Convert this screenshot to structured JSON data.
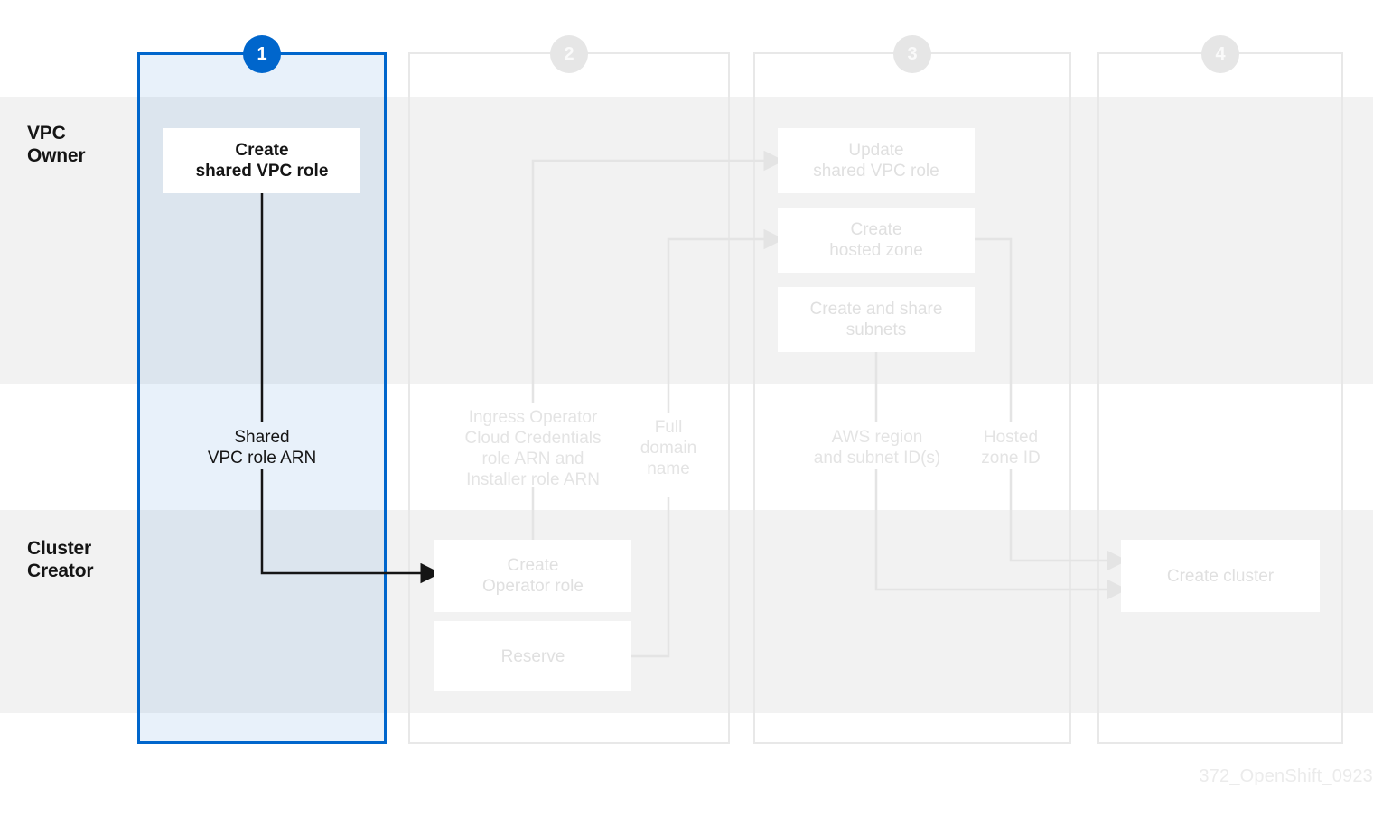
{
  "diagram": {
    "watermark": "372_OpenShift_0923",
    "accent_color": "#0066CC",
    "inactive_color": "#E0E0E0",
    "band_color": "#F2F2F2",
    "active_step": 1
  },
  "roles": [
    {
      "id": "vpc-owner",
      "label": "VPC\nOwner"
    },
    {
      "id": "cluster-creator",
      "label": "Cluster\nCreator"
    }
  ],
  "steps": [
    {
      "number": "1",
      "state": "active"
    },
    {
      "number": "2",
      "state": "inactive"
    },
    {
      "number": "3",
      "state": "inactive"
    },
    {
      "number": "4",
      "state": "inactive"
    }
  ],
  "boxes": {
    "create_shared_vpc_role": {
      "label": "Create\nshared VPC role",
      "step": 1,
      "role": "vpc-owner",
      "state": "active"
    },
    "create_operator_role": {
      "label": "Create\nOperator role",
      "step": 2,
      "role": "cluster-creator",
      "state": "inactive"
    },
    "reserve": {
      "label": "Reserve",
      "step": 2,
      "role": "cluster-creator",
      "state": "inactive"
    },
    "update_shared_vpc_role": {
      "label": "Update\nshared VPC role",
      "step": 3,
      "role": "vpc-owner",
      "state": "inactive"
    },
    "create_hosted_zone": {
      "label": "Create\nhosted zone",
      "step": 3,
      "role": "vpc-owner",
      "state": "inactive"
    },
    "create_and_share_subnets": {
      "label": "Create and share\nsubnets",
      "step": 3,
      "role": "vpc-owner",
      "state": "inactive"
    },
    "create_cluster": {
      "label": "Create cluster",
      "step": 4,
      "role": "cluster-creator",
      "state": "inactive"
    }
  },
  "flow_labels": {
    "shared_vpc_role_arn": {
      "label": "Shared\nVPC role ARN",
      "state": "active"
    },
    "ingress_installer_arn": {
      "label": "Ingress Operator\nCloud Credentials\nrole ARN and\nInstaller role ARN",
      "state": "inactive"
    },
    "full_domain_name": {
      "label": "Full\ndomain\nname",
      "state": "inactive"
    },
    "aws_region_and_subnet_ids": {
      "label": "AWS region\nand subnet ID(s)",
      "state": "inactive"
    },
    "hosted_zone_id": {
      "label": "Hosted\nzone ID",
      "state": "inactive"
    }
  }
}
